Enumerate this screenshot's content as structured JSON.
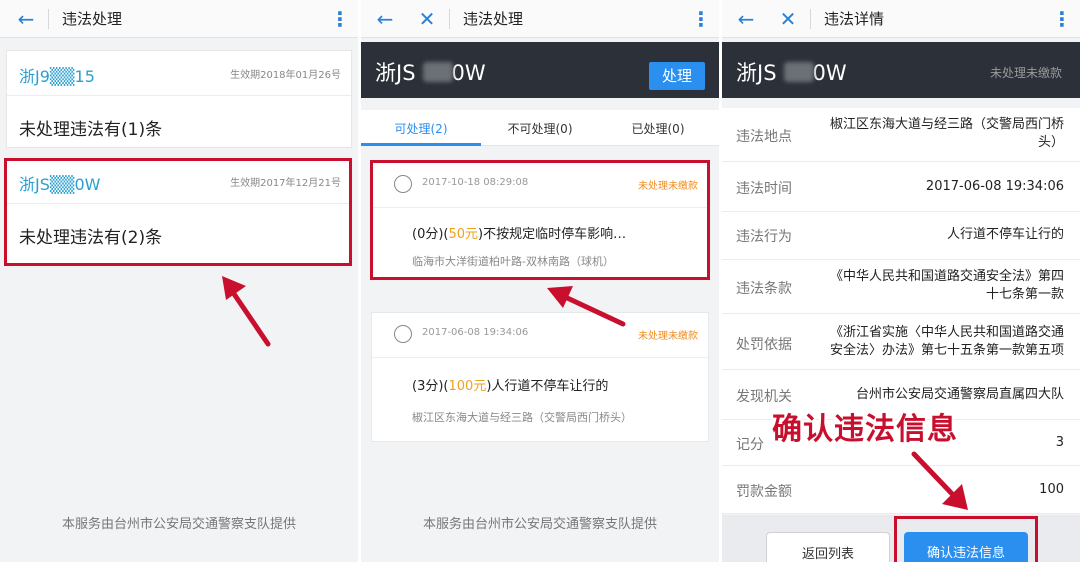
{
  "panel1": {
    "title": "违法处理",
    "cards": [
      {
        "plate": "浙J9▒▒15",
        "effective": "生效期2018年01月26号",
        "count_text": "未处理违法有(1)条"
      },
      {
        "plate": "浙JS▒▒0W",
        "effective": "生效期2017年12月21号",
        "count_text": "未处理违法有(2)条"
      }
    ],
    "footer": "本服务由台州市公安局交通警察支队提供"
  },
  "panel2": {
    "title": "违法处理",
    "plate_left": "浙JS",
    "plate_right": "0W",
    "handle_button": "处理",
    "tabs": [
      {
        "label": "可处理(2)"
      },
      {
        "label": "不可处理(0)"
      },
      {
        "label": "已处理(0)"
      }
    ],
    "violations": [
      {
        "time": "2017-10-18 08:29:08",
        "status": "未处理未缴款",
        "points": "(0分)(",
        "fine": "50元",
        "desc": ")不按规定临时停车影响…",
        "location": "临海市大洋街道柏叶路-双林南路（球机）"
      },
      {
        "time": "2017-06-08 19:34:06",
        "status": "未处理未缴款",
        "points": "(3分)(",
        "fine": "100元",
        "desc": ")人行道不停车让行的",
        "location": "椒江区东海大道与经三路（交警局西门桥头）"
      }
    ],
    "footer": "本服务由台州市公安局交通警察支队提供"
  },
  "panel3": {
    "title": "违法详情",
    "plate_left": "浙JS",
    "plate_right": "0W",
    "status": "未处理未缴款",
    "rows": [
      {
        "label": "违法地点",
        "value_line1": "椒江区东海大道与经三路（交警局西门桥",
        "value_line2": "头）"
      },
      {
        "label": "违法时间",
        "value_line1": "2017-06-08 19:34:06",
        "value_line2": ""
      },
      {
        "label": "违法行为",
        "value_line1": "人行道不停车让行的",
        "value_line2": ""
      },
      {
        "label": "违法条款",
        "value_line1": "《中华人民共和国道路交通安全法》第四",
        "value_line2": "十七条第一款"
      },
      {
        "label": "处罚依据",
        "value_line1": "《浙江省实施〈中华人民共和国道路交通",
        "value_line2": "安全法〉办法》第七十五条第一款第五项"
      },
      {
        "label": "发现机关",
        "value_line1": "台州市公安局交通警察局直属四大队",
        "value_line2": ""
      },
      {
        "label": "记分",
        "value_line1": "3",
        "value_line2": ""
      },
      {
        "label": "罚款金额",
        "value_line1": "100",
        "value_line2": ""
      }
    ],
    "back_button": "返回列表",
    "confirm_button": "确认违法信息",
    "callout": "确认违法信息"
  },
  "colors": {
    "accent": "#2b8ff0",
    "highlight_red": "#c8102e",
    "status_orange": "#f08c1e",
    "dark_header": "#2c3038"
  }
}
